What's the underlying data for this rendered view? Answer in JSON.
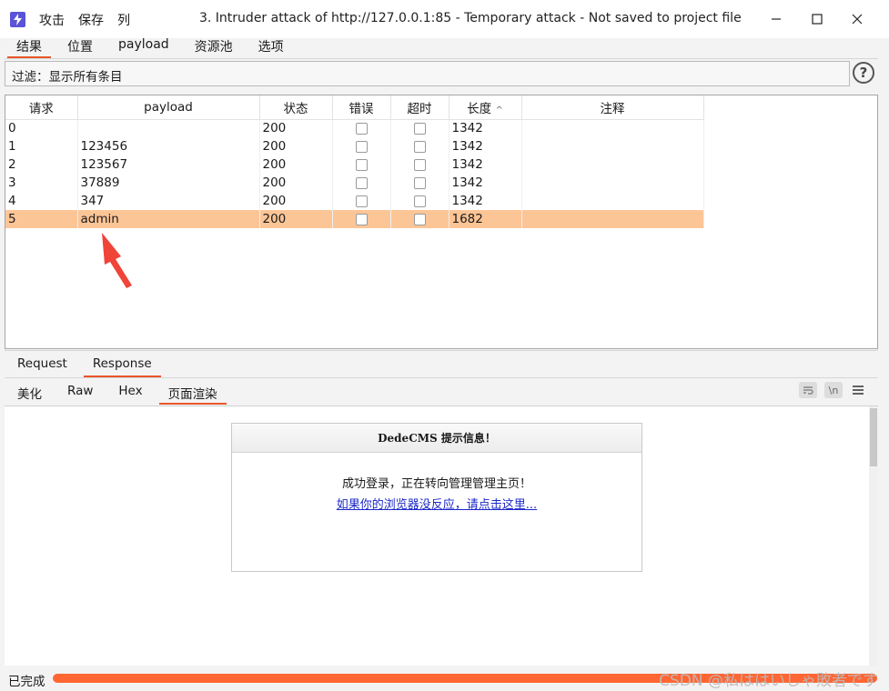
{
  "window": {
    "title": "3. Intruder attack of http://127.0.0.1:85 - Temporary attack - Not saved to project file",
    "menu": [
      "攻击",
      "保存",
      "列"
    ],
    "controls": [
      "minimize",
      "maximize",
      "close"
    ]
  },
  "main_tabs": [
    {
      "label": "结果",
      "active": true
    },
    {
      "label": "位置",
      "active": false
    },
    {
      "label": "payload",
      "active": false
    },
    {
      "label": "资源池",
      "active": false
    },
    {
      "label": "选项",
      "active": false
    }
  ],
  "filter": {
    "text": "过滤：显示所有条目"
  },
  "help_icon": "?",
  "table": {
    "columns": [
      "请求",
      "payload",
      "状态",
      "错误",
      "超时",
      "长度",
      "注释"
    ],
    "sort_indicator": "^",
    "rows": [
      {
        "req": "0",
        "payload": "",
        "status": "200",
        "error": false,
        "timeout": false,
        "length": "1342",
        "comment": ""
      },
      {
        "req": "1",
        "payload": "123456",
        "status": "200",
        "error": false,
        "timeout": false,
        "length": "1342",
        "comment": ""
      },
      {
        "req": "2",
        "payload": "123567",
        "status": "200",
        "error": false,
        "timeout": false,
        "length": "1342",
        "comment": ""
      },
      {
        "req": "3",
        "payload": "37889",
        "status": "200",
        "error": false,
        "timeout": false,
        "length": "1342",
        "comment": ""
      },
      {
        "req": "4",
        "payload": "347",
        "status": "200",
        "error": false,
        "timeout": false,
        "length": "1342",
        "comment": ""
      },
      {
        "req": "5",
        "payload": "admin",
        "status": "200",
        "error": false,
        "timeout": false,
        "length": "1682",
        "comment": ""
      }
    ],
    "selected_row": 5,
    "selected_color": "#fcc596"
  },
  "message_tabs": [
    {
      "label": "Request",
      "active": false
    },
    {
      "label": "Response",
      "active": true
    }
  ],
  "view_tabs": [
    {
      "label": "美化",
      "active": false
    },
    {
      "label": "Raw",
      "active": false
    },
    {
      "label": "Hex",
      "active": false
    },
    {
      "label": "页面渲染",
      "active": true
    }
  ],
  "view_tools": [
    "wrap-icon",
    "newline-icon",
    "menu-icon"
  ],
  "view_tool_glyphs": {
    "newline": "\\n"
  },
  "rendered_page": {
    "header": "DedeCMS 提示信息！",
    "message": "成功登录，正在转向管理管理主页！",
    "link": "如果你的浏览器没反应，请点击这里..."
  },
  "status_bar": {
    "text": "已完成",
    "progress_percent": 100,
    "progress_color": "#ff6633"
  },
  "watermark": "CSDN @私ははいしゃ敗者です",
  "accent_color": "#e8562a"
}
